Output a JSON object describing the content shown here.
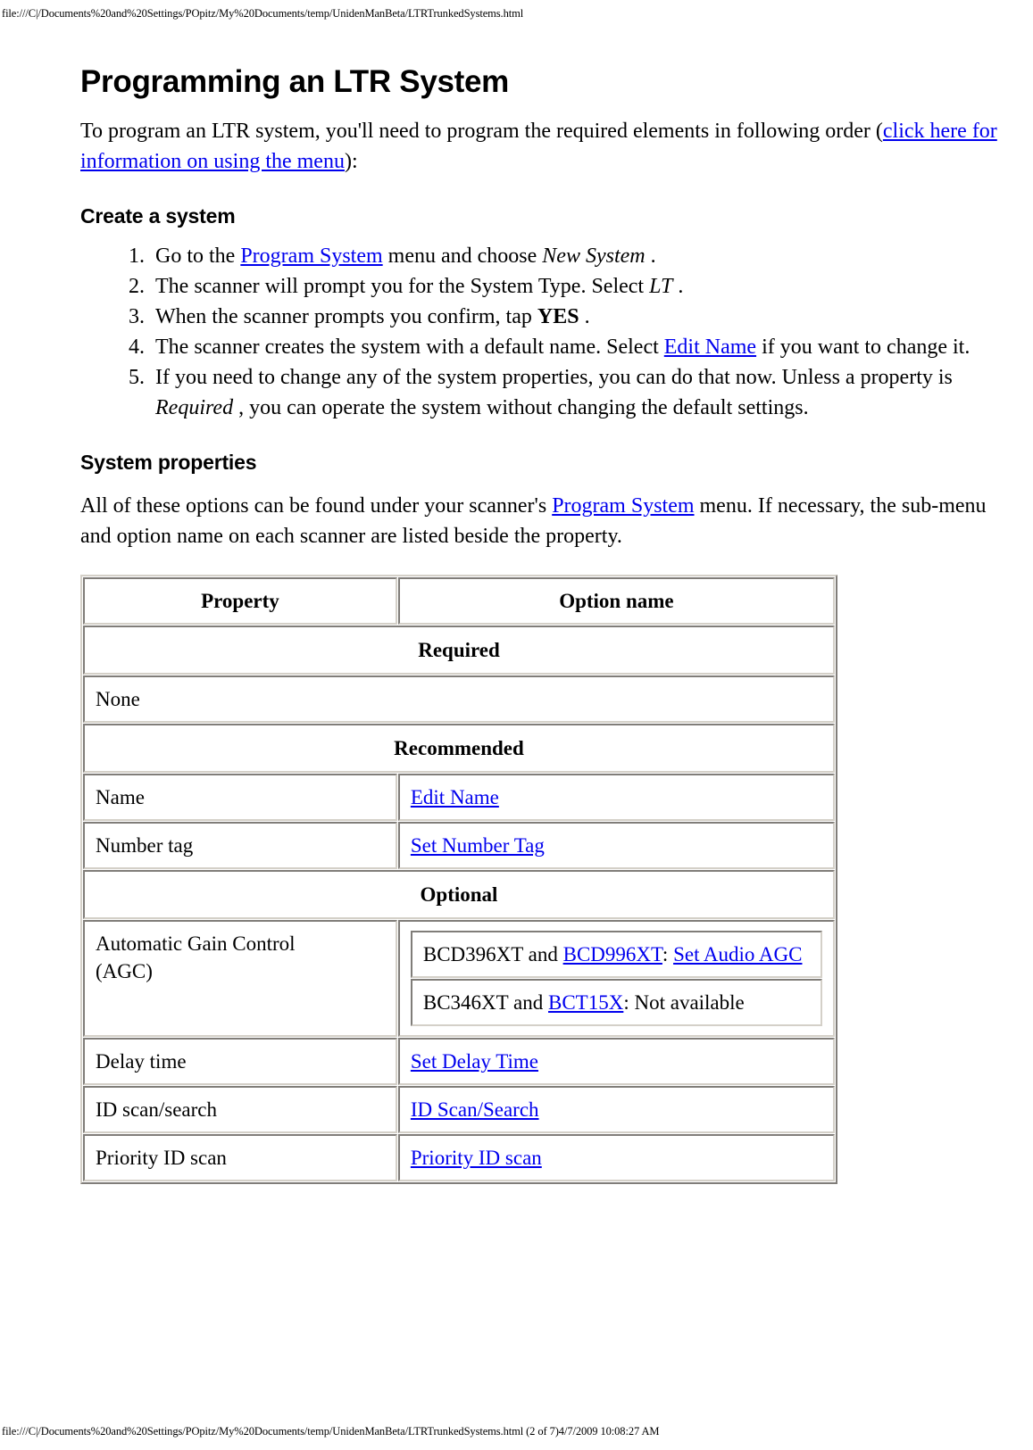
{
  "header_url": "file:///C|/Documents%20and%20Settings/POpitz/My%20Documents/temp/UnidenManBeta/LTRTrunkedSystems.html",
  "footer_url": "file:///C|/Documents%20and%20Settings/POpitz/My%20Documents/temp/UnidenManBeta/LTRTrunkedSystems.html (2 of 7)4/7/2009 10:08:27 AM",
  "page": {
    "title": "Programming an LTR System",
    "intro": {
      "before_link": "To program an LTR system, you'll need to program the required elements in following order (",
      "link": "click here for information on using the menu",
      "after_link": "):"
    },
    "create_section": {
      "heading": "Create a system",
      "steps": [
        {
          "parts": [
            {
              "type": "text",
              "value": "Go to the "
            },
            {
              "type": "link",
              "value": "Program System"
            },
            {
              "type": "text",
              "value": " menu and choose "
            },
            {
              "type": "italic",
              "value": "New System"
            },
            {
              "type": "text",
              "value": " ."
            }
          ]
        },
        {
          "parts": [
            {
              "type": "text",
              "value": "The scanner will prompt you for the System Type. Select "
            },
            {
              "type": "italic",
              "value": "LT"
            },
            {
              "type": "text",
              "value": " ."
            }
          ]
        },
        {
          "parts": [
            {
              "type": "text",
              "value": "When the scanner prompts you confirm, tap "
            },
            {
              "type": "bold",
              "value": "YES"
            },
            {
              "type": "text",
              "value": " ."
            }
          ]
        },
        {
          "parts": [
            {
              "type": "text",
              "value": "The scanner creates the system with a default name. Select "
            },
            {
              "type": "link",
              "value": "Edit Name"
            },
            {
              "type": "text",
              "value": " if you want to change it."
            }
          ]
        },
        {
          "parts": [
            {
              "type": "text",
              "value": "If you need to change any of the system properties, you can do that now. Unless a property is "
            },
            {
              "type": "italic",
              "value": "Required"
            },
            {
              "type": "text",
              "value": " , you can operate the system without changing the default settings."
            }
          ]
        }
      ]
    },
    "properties_section": {
      "heading": "System properties",
      "intro": {
        "before_link": "All of these options can be found under your scanner's ",
        "link": "Program System",
        "after_link": " menu. If necessary, the sub-menu and option name on each scanner are listed beside the property."
      },
      "table": {
        "headers": {
          "property": "Property",
          "option": "Option name"
        },
        "bands": {
          "required": "Required",
          "recommended": "Recommended",
          "optional": "Optional"
        },
        "colors": {
          "required_bg": "#CCFFCC",
          "recommended_bg": "#FCCB96",
          "optional_bg": "#FFCCCC",
          "link": "#0000EE"
        },
        "rows": {
          "required": [
            {
              "property": "None",
              "option": ""
            }
          ],
          "recommended": [
            {
              "property": "Name",
              "option_link": "Edit Name"
            },
            {
              "property": "Number tag",
              "option_link": "Set Number Tag"
            }
          ],
          "optional_agc": {
            "property_line1": "Automatic Gain Control",
            "property_line2": "(AGC)",
            "option_rows": [
              {
                "parts": [
                  {
                    "type": "text",
                    "value": "BCD396XT and "
                  },
                  {
                    "type": "link",
                    "value": "BCD996XT"
                  },
                  {
                    "type": "text",
                    "value": ": "
                  },
                  {
                    "type": "link",
                    "value": "Set Audio AGC"
                  }
                ]
              },
              {
                "parts": [
                  {
                    "type": "text",
                    "value": "BC346XT and "
                  },
                  {
                    "type": "link",
                    "value": "BCT15X"
                  },
                  {
                    "type": "text",
                    "value": ": Not available"
                  }
                ]
              }
            ]
          },
          "optional_rest": [
            {
              "property": "Delay time",
              "option_link": "Set Delay Time"
            },
            {
              "property": "ID scan/search",
              "option_link": "ID Scan/Search"
            },
            {
              "property": "Priority ID scan",
              "option_link": "Priority ID scan"
            }
          ]
        }
      }
    }
  }
}
